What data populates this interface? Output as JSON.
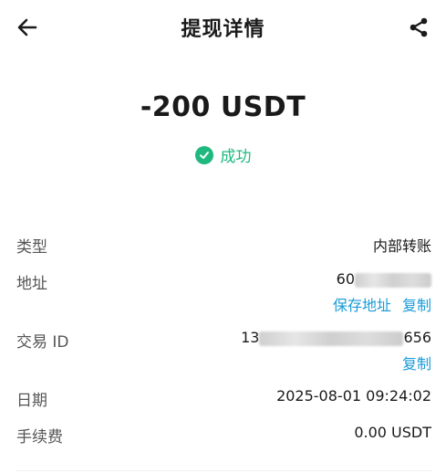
{
  "header": {
    "title": "提现详情",
    "back_icon": "arrow-left-icon",
    "share_icon": "share-icon"
  },
  "amount": "-200 USDT",
  "status": {
    "text": "成功",
    "color": "#1fb980",
    "icon": "check-circle-icon"
  },
  "details": {
    "type": {
      "label": "类型",
      "value": "内部转账"
    },
    "address": {
      "label": "地址",
      "value_visible": "60",
      "save_link": "保存地址",
      "copy_link": "复制"
    },
    "tx_id": {
      "label": "交易 ID",
      "value_prefix": "13",
      "value_suffix": "656",
      "copy_link": "复制"
    },
    "date": {
      "label": "日期",
      "value": "2025-08-01 09:24:02"
    },
    "fee": {
      "label": "手续费",
      "value": "0.00 USDT"
    }
  },
  "colors": {
    "accent": "#1a9bd7",
    "success": "#1fb980"
  }
}
